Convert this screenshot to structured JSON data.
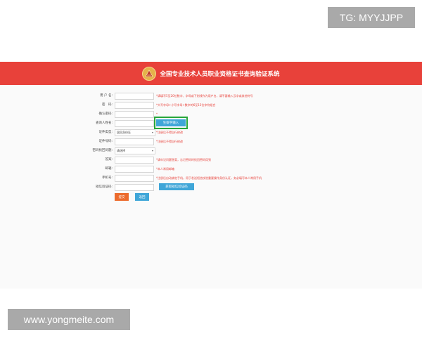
{
  "watermarks": {
    "top": "TG: MYYJJPP",
    "bottom": "www.yongmeite.com"
  },
  "header": {
    "title": "全国专业技术人员职业资格证书查询验证系统",
    "bg_color": "#e8413a"
  },
  "form": {
    "fields": [
      {
        "label": "用 户 名:",
        "hint": "*请填写5至20位数字、字母或下划线作为用户名，请不要输入汉字或其他符号"
      },
      {
        "label": "密　码:",
        "hint": "*大写字母+小写字母+数字的6至15位字符组合"
      },
      {
        "label": "确认密码:",
        "hint": "*"
      },
      {
        "label": "查询人姓名:",
        "button": "生僻字输入"
      },
      {
        "label": "证件类型:",
        "select": "居民身份证",
        "hint": "*注册后不得自行修改"
      },
      {
        "label": "证件号码:",
        "hint": "*注册后不得自行修改"
      },
      {
        "label": "密码找回问题:",
        "select": "请选择"
      },
      {
        "label": "答案:",
        "hint": "*请牢记问题答案，忘记密码时找回密码用到"
      },
      {
        "label": "邮箱:",
        "hint": "*本人常用邮箱"
      },
      {
        "label": "手机号:",
        "hint": "*注册后自动绑定手机，用于发送短信校验重要操作身份认证，务必填写本人常用手机"
      },
      {
        "label": "短信验证码:",
        "button": "获取短信验证码"
      }
    ],
    "submit_label": "提交",
    "back_label": "返回"
  },
  "colors": {
    "accent_blue": "#3fa6d8",
    "submit_orange": "#ec6b2d",
    "highlight_green": "#27a63a"
  }
}
